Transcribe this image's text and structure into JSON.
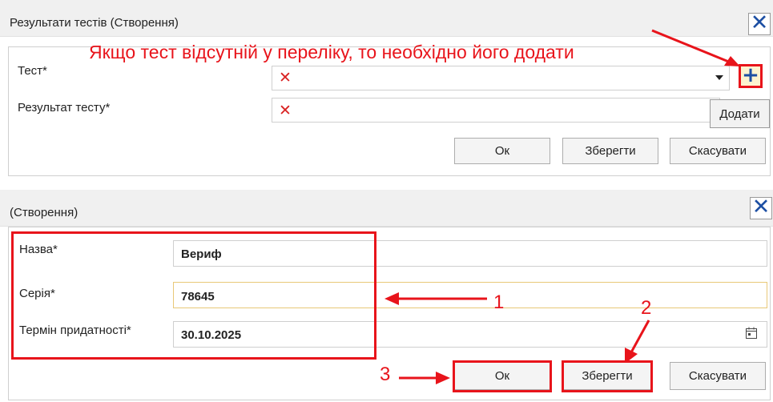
{
  "dialog1": {
    "title": "Результати тестів (Створення)",
    "annotation": "Якщо тест відсутній у переліку, то необхідно його додати",
    "fields": [
      {
        "label": "Тест*",
        "value_icon": "error-x-icon"
      },
      {
        "label": "Результат тесту*",
        "value_icon": "error-x-icon"
      }
    ],
    "add_tooltip": "Додати",
    "buttons": {
      "ok": "Ок",
      "save": "Зберегти",
      "cancel": "Скасувати"
    }
  },
  "dialog2": {
    "title": "(Створення)",
    "fields": [
      {
        "label": "Назва*",
        "value": "Вериф"
      },
      {
        "label": "Серія*",
        "value": "78645"
      },
      {
        "label": "Термін придатності*",
        "value": "30.10.2025"
      }
    ],
    "buttons": {
      "ok": "Ок",
      "save": "Зберегти",
      "cancel": "Скасувати"
    }
  },
  "callouts": {
    "one": "1",
    "two": "2",
    "three": "3"
  },
  "colors": {
    "annotation_red": "#e8141b",
    "close_blue": "#1d4fa3",
    "error_red": "#d92222"
  }
}
